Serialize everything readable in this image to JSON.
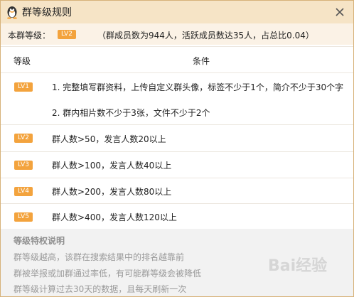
{
  "window": {
    "title": "群等级规则"
  },
  "summary": {
    "label": "本群等级：",
    "level_badge": "LV2",
    "stats": "（群成员数为944人，活跃成员数达35人，占总比0.04）"
  },
  "table": {
    "headers": [
      "等级",
      "条件"
    ],
    "rows": [
      {
        "badge": "LV1",
        "lines": [
          "1. 完整填写群资料，上传自定义群头像，标签不少于1个，简介不少于30个字",
          "2. 群内相片数不少于3张，文件不少于2个"
        ]
      },
      {
        "badge": "LV2",
        "lines": [
          "群人数>50，发言人数20以上"
        ]
      },
      {
        "badge": "LV3",
        "lines": [
          "群人数>100，发言人数40以上"
        ]
      },
      {
        "badge": "LV4",
        "lines": [
          "群人数>200，发言人数80以上"
        ]
      },
      {
        "badge": "LV5",
        "lines": [
          "群人数>400，发言人数120以上"
        ]
      }
    ]
  },
  "footer": {
    "heading": "等级特权说明",
    "lines": [
      "群等级越高，该群在搜索结果中的排名越靠前",
      "群被举报或加群通过率低，有可能群等级会被降低",
      "群等级计算过去30天的数据，且每天刷新一次"
    ]
  },
  "watermark": "Bai经验",
  "colors": {
    "titlebar": "#f6e4c6",
    "badge": "#f3a33d",
    "summary_bg": "#fbf2e6",
    "footer_bg": "#f2f2f2"
  },
  "icons": {
    "title": "qq-penguin-icon",
    "close": "close-icon"
  }
}
